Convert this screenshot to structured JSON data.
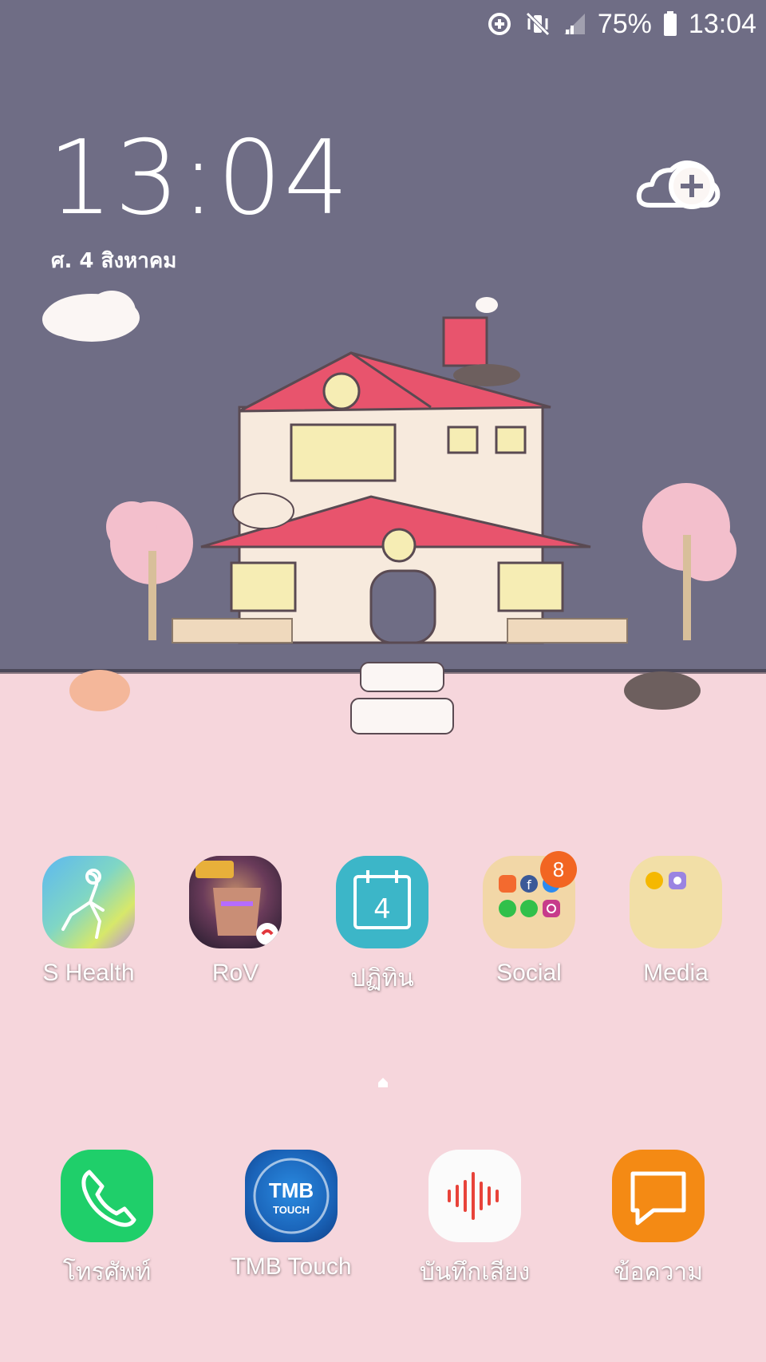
{
  "status_bar": {
    "battery_percent": "75%",
    "time": "13:04",
    "icons": [
      "data-saver-icon",
      "vibrate-icon",
      "signal-icon",
      "battery-icon"
    ]
  },
  "lockclock": {
    "time": "13:04",
    "date": "ศ. 4 สิงหาคม"
  },
  "home_apps": [
    {
      "label": "S Health",
      "icon": "s-health-icon"
    },
    {
      "label": "RoV",
      "icon": "rov-game-icon"
    },
    {
      "label": "ปฏิทิน",
      "icon": "calendar-icon",
      "calendar_day": "4"
    },
    {
      "label": "Social",
      "icon": "social-folder-icon",
      "badge": "8"
    },
    {
      "label": "Media",
      "icon": "media-folder-icon"
    }
  ],
  "dock_apps": [
    {
      "label": "โทรศัพท์",
      "icon": "phone-icon"
    },
    {
      "label": "TMB Touch",
      "icon": "tmb-touch-icon",
      "icon_text": "TMB",
      "icon_subtext": "TOUCH"
    },
    {
      "label": "บันทึกเสียง",
      "icon": "voice-recorder-icon"
    },
    {
      "label": "ข้อความ",
      "icon": "messages-icon"
    }
  ],
  "colors": {
    "sky": "#6f6d85",
    "ground": "#f6d6dc",
    "badge": "#f26522",
    "phone": "#1fcf6a",
    "calendar": "#3cb6c8",
    "messages": "#f48a14",
    "tmb": "#1a63b8"
  }
}
